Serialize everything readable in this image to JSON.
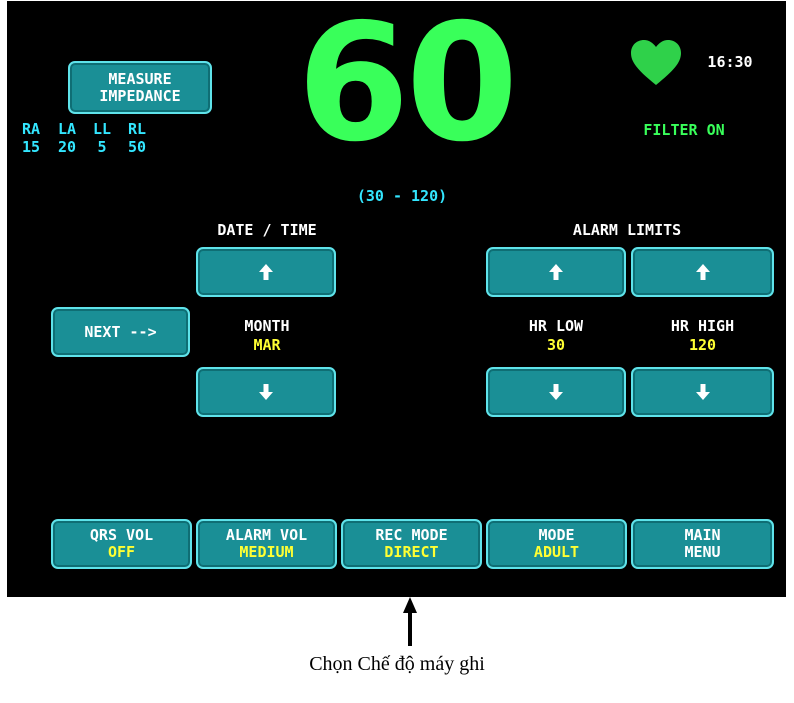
{
  "impedance": {
    "button": [
      "MEASURE",
      "IMPEDANCE"
    ],
    "leads": [
      "RA",
      "LA",
      "LL",
      "RL"
    ],
    "values": [
      "15",
      "20",
      "5",
      "50"
    ]
  },
  "heart_rate": {
    "value": "60",
    "range": "(30 - 120)"
  },
  "status": {
    "time": "16:30",
    "filter": "FILTER ON"
  },
  "date_time": {
    "title": "DATE / TIME",
    "field": "MONTH",
    "value": "MAR"
  },
  "next_label": "NEXT -->",
  "alarm_limits": {
    "title": "ALARM LIMITS",
    "low_label": "HR LOW",
    "low_value": "30",
    "high_label": "HR HIGH",
    "high_value": "120"
  },
  "bottom_menu": [
    {
      "label": "QRS VOL",
      "value": "OFF"
    },
    {
      "label": "ALARM VOL",
      "value": "MEDIUM"
    },
    {
      "label": "REC MODE",
      "value": "DIRECT"
    },
    {
      "label": "MODE",
      "value": "ADULT"
    },
    {
      "label": "MAIN",
      "value": "MENU"
    }
  ],
  "caption": "Chọn Chế độ máy ghi",
  "icons": {
    "heart": "heart-icon",
    "up": "up-arrow-icon",
    "down": "down-arrow-icon",
    "pointer": "pointer-arrow"
  },
  "colors": {
    "screen": "#000000",
    "button": "#1a8f96",
    "button_border": "#5fe3ea",
    "hr_digits": "#39ff5a",
    "cyan_text": "#33e6ff",
    "yellow_text": "#ffff33"
  }
}
